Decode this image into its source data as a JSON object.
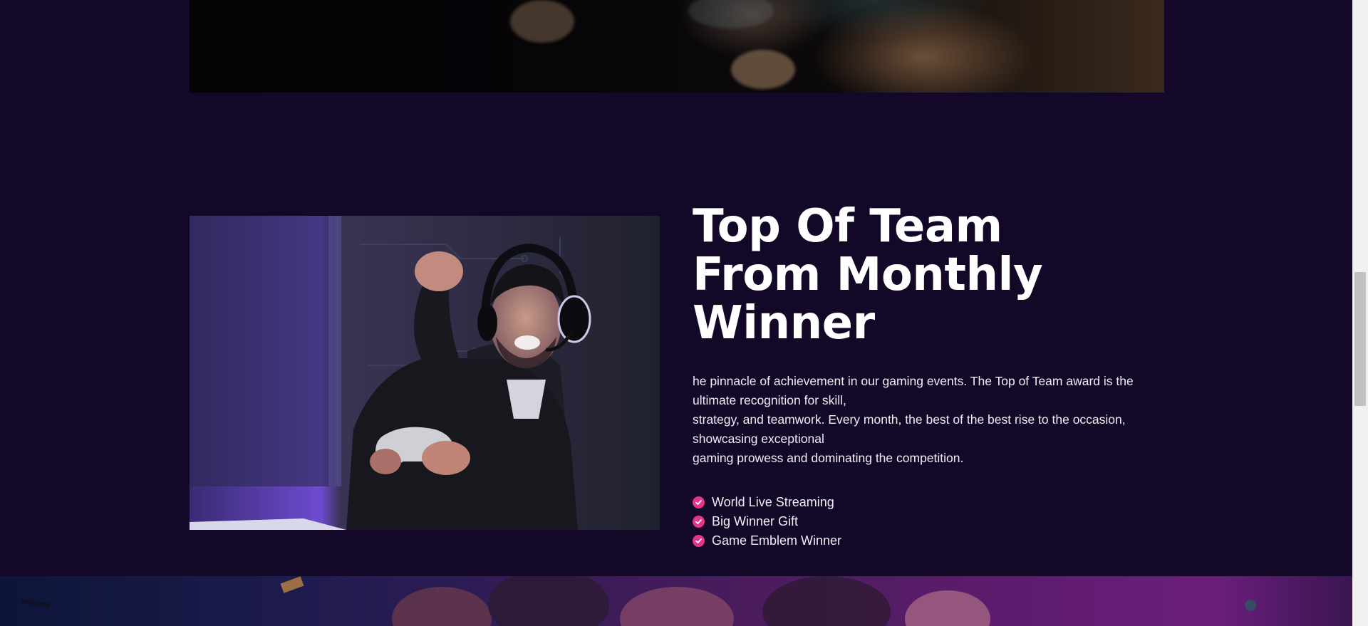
{
  "feature": {
    "title_lines": [
      "Top Of Team",
      "From Monthly",
      "Winner"
    ],
    "description_lines": [
      "he pinnacle of achievement in our gaming events. The Top of Team award is the ultimate recognition for skill,",
      "strategy, and teamwork. Every month, the best of the best rise to the occasion, showcasing exceptional",
      "gaming prowess and dominating the competition."
    ],
    "items": [
      {
        "label": "World Live Streaming",
        "icon": "check-circle-icon"
      },
      {
        "label": "Big Winner Gift",
        "icon": "check-circle-icon"
      },
      {
        "label": "Game Emblem Winner",
        "icon": "check-circle-icon"
      }
    ]
  },
  "colors": {
    "background": "#140828",
    "accent": "#e4358a",
    "text": "#ffffff"
  },
  "scrollbar": {
    "position_fraction": 0.46
  }
}
